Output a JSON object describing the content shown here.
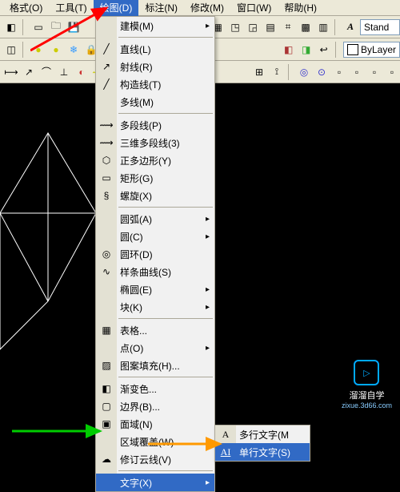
{
  "menubar": {
    "format": "格式(O)",
    "tools": "工具(T)",
    "draw": "绘图(D)",
    "dim": "标注(N)",
    "modify": "修改(M)",
    "window": "窗口(W)",
    "help": "帮助(H)"
  },
  "toolbar2": {
    "stand": "Stand",
    "bylayer": "ByLayer"
  },
  "dropdown": {
    "model": "建模(M)",
    "line": "直线(L)",
    "ray": "射线(R)",
    "xline": "构造线(T)",
    "mline": "多线(M)",
    "pline": "多段线(P)",
    "pline3d": "三维多段线(3)",
    "polygon": "正多边形(Y)",
    "rect": "矩形(G)",
    "helix": "螺旋(X)",
    "arc": "圆弧(A)",
    "circle": "圆(C)",
    "donut": "圆环(D)",
    "spline": "样条曲线(S)",
    "ellipse": "椭圆(E)",
    "block": "块(K)",
    "table": "表格...",
    "point": "点(O)",
    "hatch": "图案填充(H)...",
    "gradient": "渐变色...",
    "boundary": "边界(B)...",
    "region": "面域(N)",
    "wipeout": "区域覆盖(W)",
    "revcloud": "修订云线(V)",
    "text": "文字(X)"
  },
  "submenu": {
    "mtext": "多行文字(M",
    "dtext": "单行文字(S)"
  },
  "watermark": {
    "brand": "溜溜自学",
    "url": "zixue.3d66.com"
  }
}
